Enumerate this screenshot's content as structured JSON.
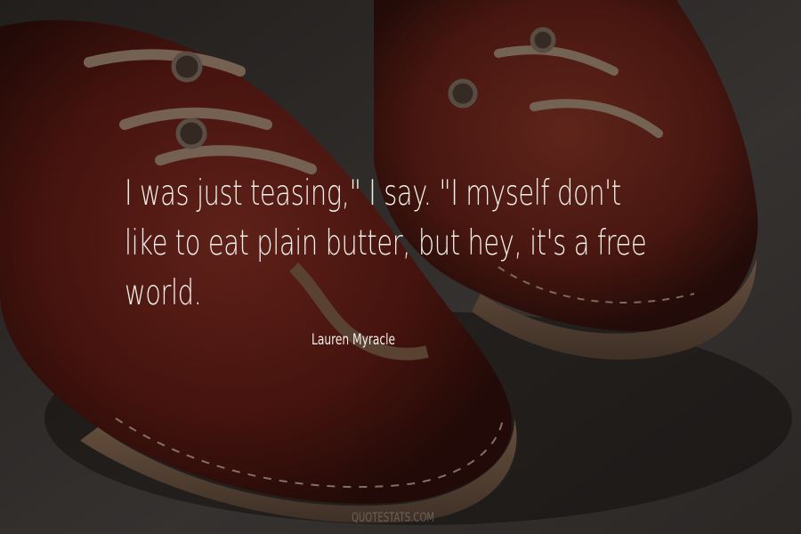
{
  "quote": {
    "lines": [
      "I was just teasing,\" I say. \"I myself don't",
      "like to eat plain butter, but hey, it's a free",
      "world."
    ]
  },
  "author": "Lauren Myracle",
  "watermark": "QUOTESTATS.COM",
  "colors": {
    "text": "#f2efe9",
    "shoe_red": "#8e2e22",
    "background": "#4a4440"
  }
}
